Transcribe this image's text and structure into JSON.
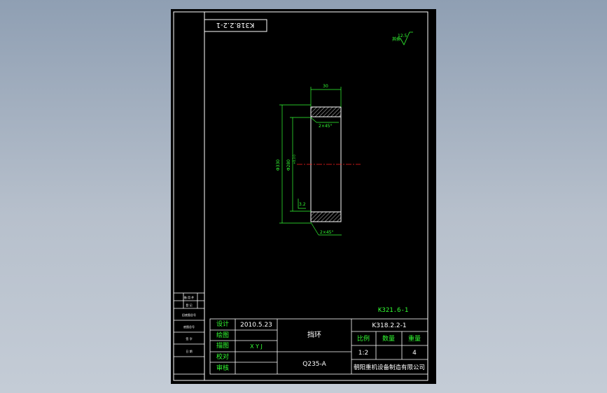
{
  "drawing": {
    "code_box": "K318.2.2-1",
    "roughness": {
      "label": "其余",
      "value": "12.5"
    },
    "dims": {
      "width": "30",
      "chamfer_top": "2×45°",
      "outer_dia": "Φ330",
      "inner_dia": "Φ280",
      "inner_tol": "+0.3 0",
      "surface_small": "3.2",
      "chamfer_bottom": "2×45°"
    },
    "assembly_code": "K321.6-1"
  },
  "title_block": {
    "left_rows": [
      "借 用 件",
      "登 记",
      "旧底图总号",
      "底图总号",
      "签 字",
      "日 期"
    ],
    "labels": {
      "design": "设计",
      "draw": "绘图",
      "trace": "描图",
      "check": "校对",
      "review": "审核"
    },
    "values": {
      "design_date": "2010.5.23",
      "trace_name": "X Y J"
    },
    "part_name": "挡环",
    "material": "Q235-A",
    "drawing_no": "K318.2.2-1",
    "scale_label": "比例",
    "qty_label": "数量",
    "weight_label": "重量",
    "scale_value": "1:2",
    "weight_value": "4",
    "company": "朝阳重机设备制造有限公司"
  }
}
